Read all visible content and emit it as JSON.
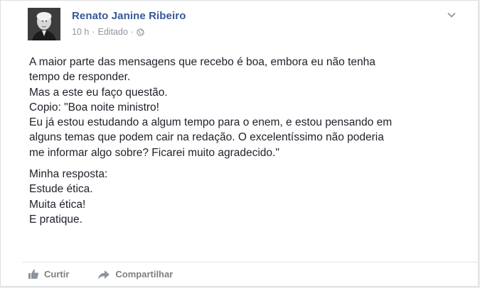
{
  "post": {
    "author": "Renato Janine Ribeiro",
    "time": "10 h",
    "separator": "·",
    "edited": "Editado",
    "separator2": "·",
    "privacy_icon": "globe-icon",
    "menu_icon": "chevron-down-icon",
    "lines": [
      "A maior parte das mensagens que recebo é boa, embora eu não tenha",
      "tempo de responder.",
      "Mas a este eu faço questão.",
      "Copio: \"Boa noite ministro!",
      "Eu já estou estudando a algum tempo para o enem, e estou pensando em",
      "alguns temas que podem cair na redação. O excelentíssimo não poderia",
      "me informar algo sobre? Ficarei muito agradecido.\""
    ],
    "lines2": [
      "Minha resposta:",
      "Estude ética.",
      "Muita ética!",
      "E pratique."
    ]
  },
  "actions": {
    "like_label": "Curtir",
    "like_icon": "thumbs-up-icon",
    "share_label": "Compartilhar",
    "share_icon": "share-arrow-icon"
  },
  "colors": {
    "author": "#365899",
    "meta": "#90949c",
    "text": "#1d2129",
    "action": "#7f7f7f"
  }
}
